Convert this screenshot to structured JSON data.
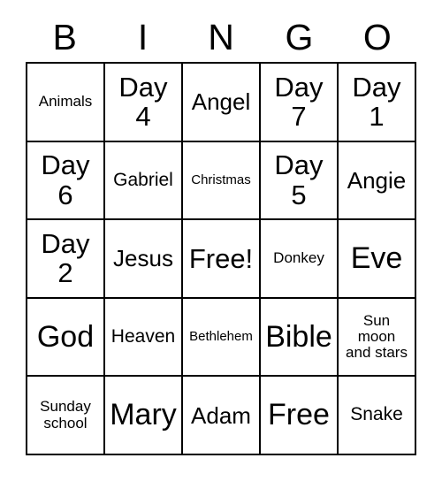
{
  "card": {
    "headers": [
      "B",
      "I",
      "N",
      "G",
      "O"
    ],
    "colors": {
      "border": "#000000",
      "background": "#ffffff",
      "text": "#000000"
    },
    "rows": [
      [
        {
          "text": "Animals",
          "size": "s"
        },
        {
          "text": "Day\n4",
          "size": "xl"
        },
        {
          "text": "Angel",
          "size": "l"
        },
        {
          "text": "Day\n7",
          "size": "xl"
        },
        {
          "text": "Day\n1",
          "size": "xl"
        }
      ],
      [
        {
          "text": "Day\n6",
          "size": "xl"
        },
        {
          "text": "Gabriel",
          "size": "m"
        },
        {
          "text": "Christmas",
          "size": "xs"
        },
        {
          "text": "Day\n5",
          "size": "xl"
        },
        {
          "text": "Angie",
          "size": "l"
        }
      ],
      [
        {
          "text": "Day\n2",
          "size": "xl"
        },
        {
          "text": "Jesus",
          "size": "l"
        },
        {
          "text": "Free!",
          "size": "xl"
        },
        {
          "text": "Donkey",
          "size": "s"
        },
        {
          "text": "Eve",
          "size": "xxl"
        }
      ],
      [
        {
          "text": "God",
          "size": "xxl"
        },
        {
          "text": "Heaven",
          "size": "m"
        },
        {
          "text": "Bethlehem",
          "size": "xs"
        },
        {
          "text": "Bible",
          "size": "xxl"
        },
        {
          "text": "Sun\nmoon\nand stars",
          "size": "s"
        }
      ],
      [
        {
          "text": "Sunday\nschool",
          "size": "s"
        },
        {
          "text": "Mary",
          "size": "xxl"
        },
        {
          "text": "Adam",
          "size": "l"
        },
        {
          "text": "Free",
          "size": "xxl"
        },
        {
          "text": "Snake",
          "size": "m"
        }
      ]
    ]
  }
}
